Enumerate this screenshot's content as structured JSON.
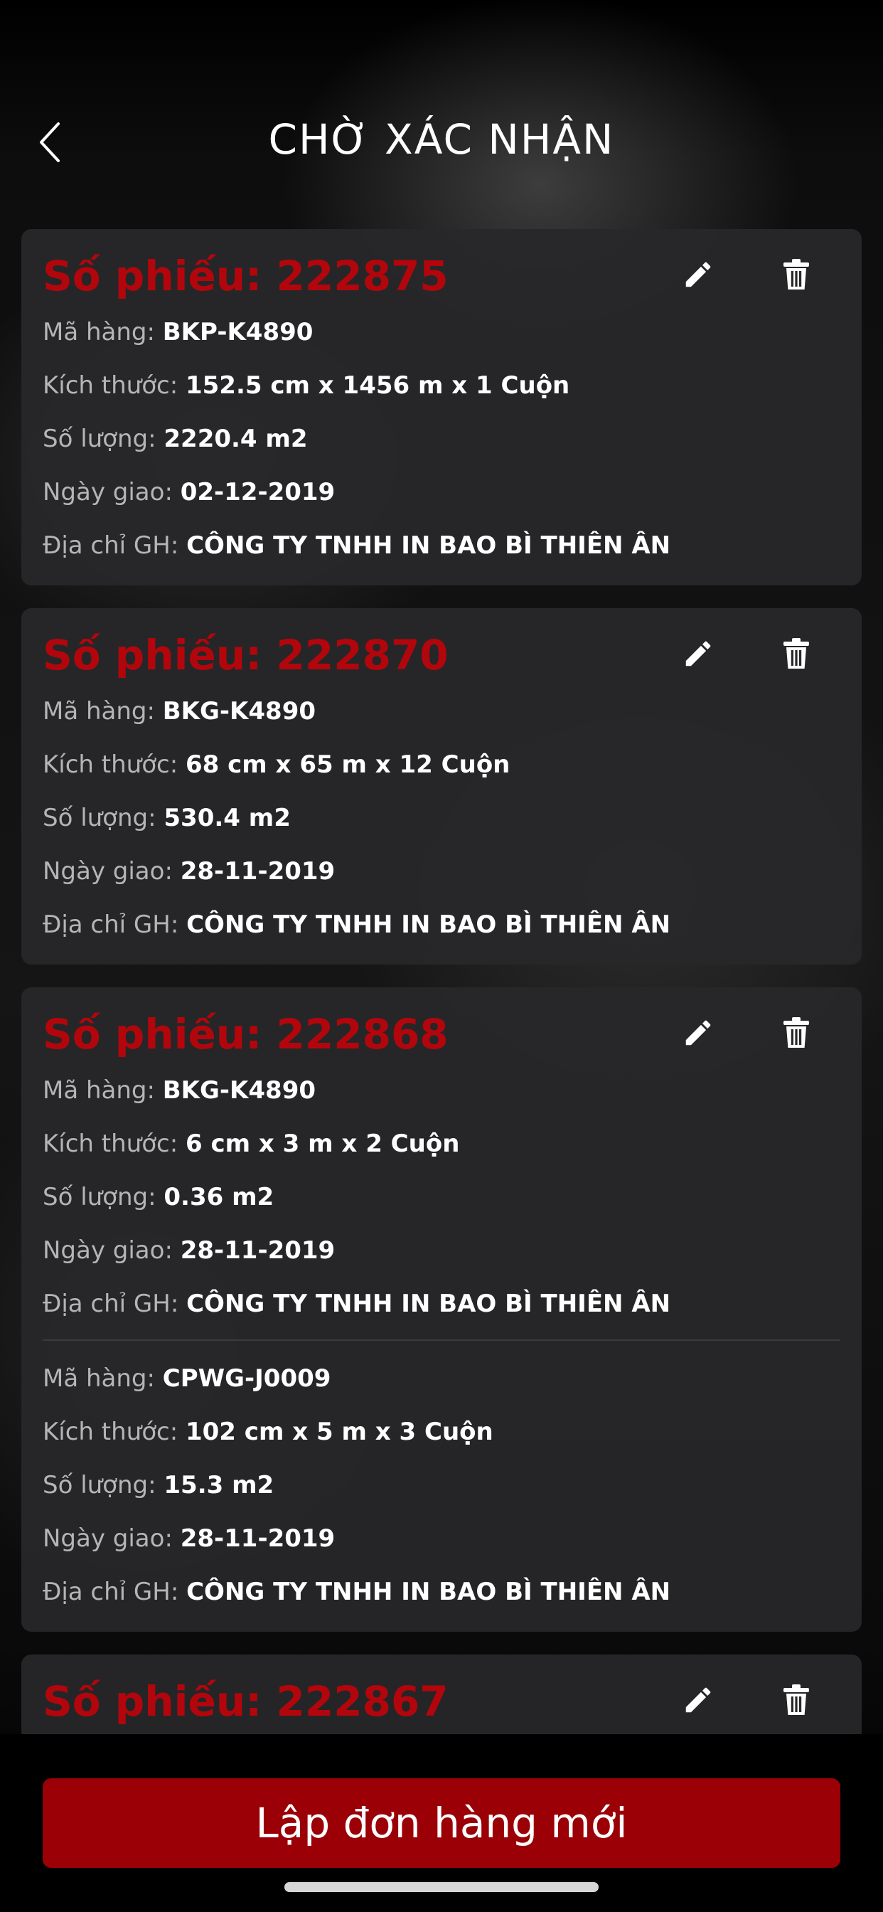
{
  "header": {
    "title": "CHỜ XÁC NHẬN",
    "back_icon": "chevron-left-icon"
  },
  "labels": {
    "ticket_prefix": "Số phiếu: ",
    "product_code": "Mã hàng: ",
    "size": "Kích thước: ",
    "quantity": "Số lượng: ",
    "delivery_date": "Ngày giao: ",
    "address": "Địa chỉ GH: "
  },
  "orders": [
    {
      "ticket": "222875",
      "items": [
        {
          "code": "BKP-K4890",
          "size": "152.5 cm x 1456 m x 1 Cuộn",
          "quantity": "2220.4 m2",
          "date": "02-12-2019",
          "address": "CÔNG TY TNHH IN BAO BÌ THIÊN ÂN"
        }
      ]
    },
    {
      "ticket": "222870",
      "items": [
        {
          "code": "BKG-K4890",
          "size": "68 cm x 65 m x 12 Cuộn",
          "quantity": "530.4 m2",
          "date": "28-11-2019",
          "address": "CÔNG TY TNHH IN BAO BÌ THIÊN ÂN"
        }
      ]
    },
    {
      "ticket": "222868",
      "items": [
        {
          "code": "BKG-K4890",
          "size": "6 cm x 3 m x 2 Cuộn",
          "quantity": "0.36 m2",
          "date": "28-11-2019",
          "address": "CÔNG TY TNHH IN BAO BÌ THIÊN ÂN"
        },
        {
          "code": "CPWG-J0009",
          "size": "102 cm x 5 m x 3 Cuộn",
          "quantity": "15.3 m2",
          "date": "28-11-2019",
          "address": "CÔNG TY TNHH IN BAO BÌ THIÊN ÂN"
        }
      ]
    },
    {
      "ticket": "222867",
      "items": []
    }
  ],
  "actions": {
    "edit_icon": "pencil-icon",
    "delete_icon": "trash-icon",
    "new_order_label": "Lập đơn hàng mới"
  },
  "colors": {
    "accent_red": "#b3060c",
    "button_red": "#9a0006",
    "card_bg": "#28282a"
  }
}
